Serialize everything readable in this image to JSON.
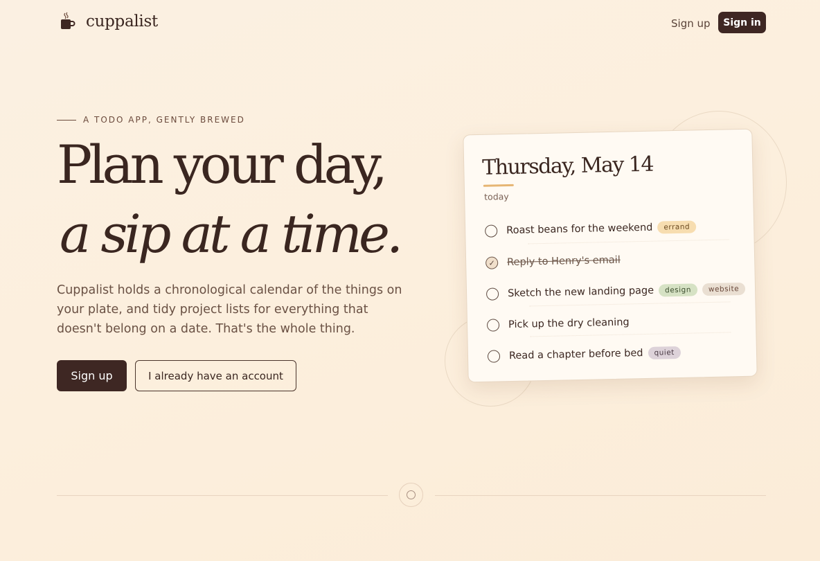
{
  "nav": {
    "brand": "cuppalist",
    "signup_label": "Sign up",
    "signin_label": "Sign in"
  },
  "hero": {
    "eyebrow": "A TODO APP, GENTLY BREWED",
    "headline_line1": "Plan your day,",
    "headline_line2": "a sip at a time.",
    "lede": "Cuppalist holds a chronological calendar of the things on your plate, and tidy project lists for everything that doesn't belong on a date. That's the whole thing.",
    "primary_cta": "Sign up",
    "secondary_cta": "I already have an account"
  },
  "card": {
    "date": "Thursday, May 14",
    "subtitle": "today",
    "tasks": [
      {
        "label": "Roast beans for the weekend",
        "done": false,
        "tags": [
          "errand"
        ]
      },
      {
        "label": "Reply to Henry's email",
        "done": true,
        "tags": []
      },
      {
        "label": "Sketch the new landing page",
        "done": false,
        "tags": [
          "design",
          "website"
        ]
      },
      {
        "label": "Pick up the dry cleaning",
        "done": false,
        "tags": []
      },
      {
        "label": "Read a chapter before bed",
        "done": false,
        "tags": [
          "quiet"
        ]
      }
    ],
    "check_glyph": "✓"
  },
  "colors": {
    "brand_dark": "#3e2723",
    "accent": "#e6b573",
    "tag_errand": "#f7ddb0",
    "tag_design": "#d6e2c4",
    "tag_website": "#eadfd2",
    "tag_quiet": "#ddd2d9"
  },
  "icons": {
    "logo": "coffee-cup-icon",
    "footer": "circle-icon"
  }
}
